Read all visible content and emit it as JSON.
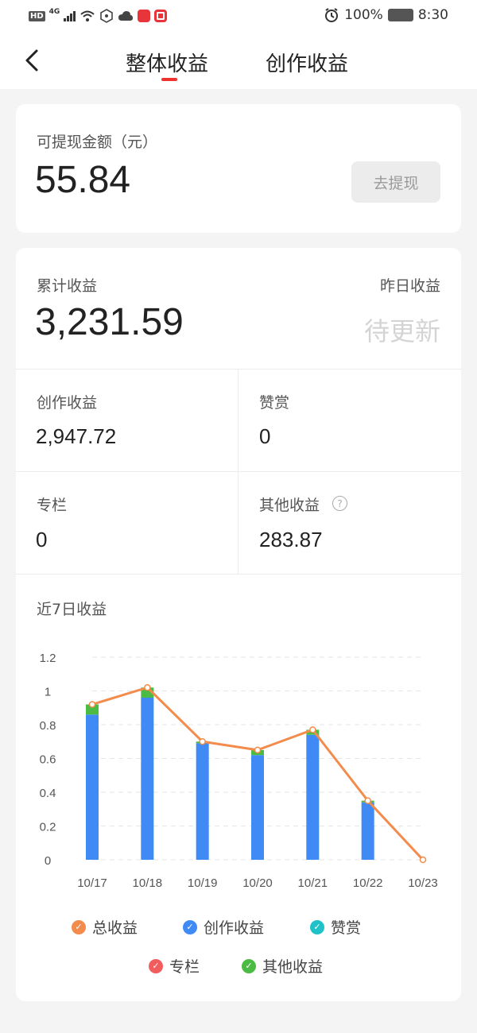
{
  "status_bar": {
    "battery": "100%",
    "time": "8:30",
    "hd": "HD",
    "net": "4G"
  },
  "header": {
    "tabs": [
      {
        "label": "整体收益",
        "active": true
      },
      {
        "label": "创作收益",
        "active": false
      }
    ],
    "accent": "#f0322f"
  },
  "withdraw": {
    "label": "可提现金额（元）",
    "amount": "55.84",
    "button": "去提现"
  },
  "summary": {
    "total_label": "累计收益",
    "total_value": "3,231.59",
    "yesterday_label": "昨日收益",
    "yesterday_value": "待更新",
    "grid": [
      {
        "label": "创作收益",
        "value": "2,947.72"
      },
      {
        "label": "赞赏",
        "value": "0"
      },
      {
        "label": "专栏",
        "value": "0"
      },
      {
        "label": "其他收益",
        "value": "283.87",
        "help": true
      }
    ]
  },
  "chart_title": "近7日收益",
  "chart_data": {
    "type": "bar",
    "categories": [
      "10/17",
      "10/18",
      "10/19",
      "10/20",
      "10/21",
      "10/22",
      "10/23"
    ],
    "ylim": [
      0,
      1.2
    ],
    "yticks": [
      "1.2",
      "1",
      "0.8",
      "0.6",
      "0.4",
      "0.2",
      "0"
    ],
    "series": [
      {
        "name": "总收益",
        "type": "line",
        "color": "#f28b4b",
        "values": [
          0.92,
          1.02,
          0.7,
          0.65,
          0.77,
          0.35,
          0.0
        ]
      },
      {
        "name": "创作收益",
        "type": "bar",
        "color": "#3f8af5",
        "values": [
          0.86,
          0.96,
          0.69,
          0.62,
          0.74,
          0.34,
          0.0
        ]
      },
      {
        "name": "赞赏",
        "type": "bar",
        "color": "#1fc2c9",
        "values": [
          0,
          0,
          0,
          0,
          0,
          0,
          0
        ]
      },
      {
        "name": "专栏",
        "type": "bar",
        "color": "#f25c5c",
        "values": [
          0,
          0,
          0,
          0,
          0,
          0,
          0
        ]
      },
      {
        "name": "其他收益",
        "type": "bar",
        "color": "#4cbb44",
        "values": [
          0.06,
          0.06,
          0.01,
          0.03,
          0.03,
          0.01,
          0.0
        ]
      }
    ],
    "grid": true,
    "legend_position": "bottom"
  }
}
